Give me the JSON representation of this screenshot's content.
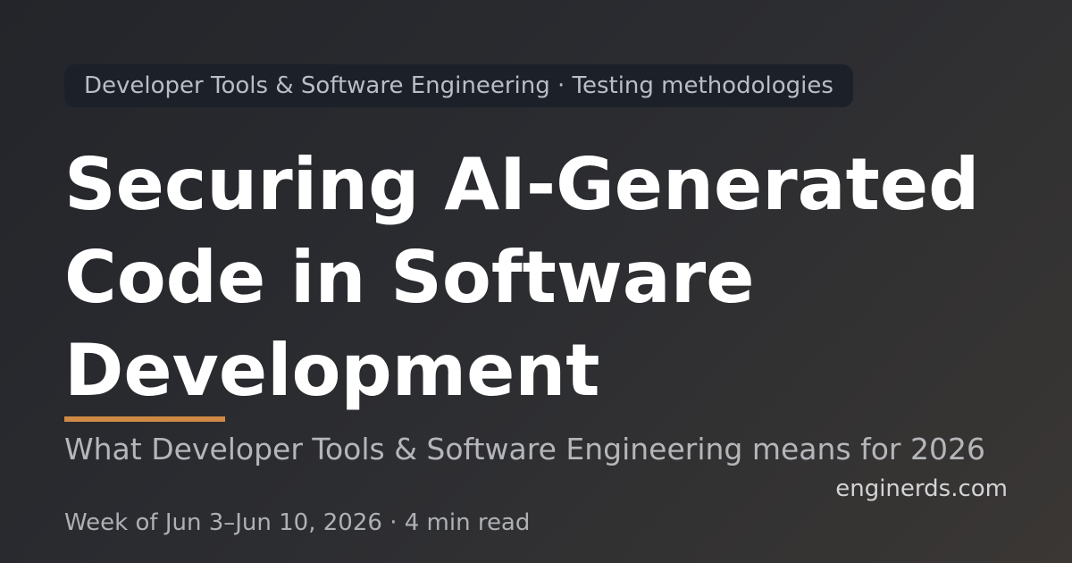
{
  "category": "Developer Tools & Software Engineering · Testing methodologies",
  "title": "Securing AI-Generated Code in Software Development",
  "subtitle": "What Developer Tools & Software Engineering means for 2026",
  "site": "enginerds.com",
  "meta": "Week of Jun 3–Jun 10, 2026 · 4 min read",
  "colors": {
    "accent": "#d08a45",
    "background_start": "#23252a",
    "background_end": "#3a3734",
    "pill_background": "#1b2029",
    "title_text": "#ffffff"
  }
}
